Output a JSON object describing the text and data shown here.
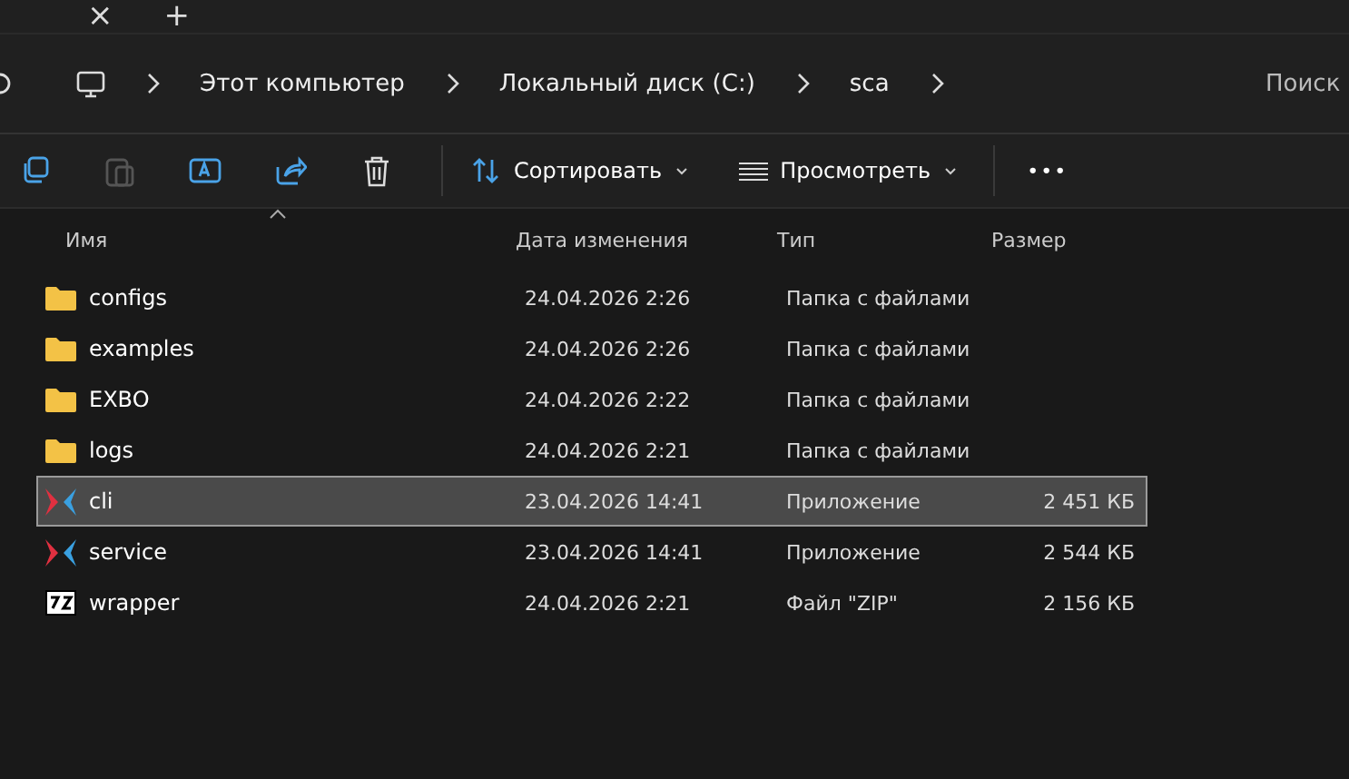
{
  "tab_strip": {
    "close": "×",
    "new_tab": "+"
  },
  "address_bar": {
    "crumbs": [
      "Этот компьютер",
      "Локальный диск (C:)",
      "sca"
    ],
    "search": {
      "placeholder": "Поиск"
    }
  },
  "toolbar": {
    "sort": "Сортировать",
    "view": "Просмотреть",
    "more": "•••"
  },
  "table": {
    "columns": [
      "Имя",
      "Дата изменения",
      "Тип",
      "Размер"
    ],
    "rows": [
      {
        "kind": "folder",
        "name": "configs",
        "date": "24.04.2026 2:26",
        "type": "Папка с файлами",
        "size": "",
        "selected": false
      },
      {
        "kind": "folder",
        "name": "examples",
        "date": "24.04.2026 2:26",
        "type": "Папка с файлами",
        "size": "",
        "selected": false
      },
      {
        "kind": "folder",
        "name": "EXBO",
        "date": "24.04.2026 2:22",
        "type": "Папка с файлами",
        "size": "",
        "selected": false
      },
      {
        "kind": "folder",
        "name": "logs",
        "date": "24.04.2026 2:21",
        "type": "Папка с файлами",
        "size": "",
        "selected": false
      },
      {
        "kind": "app",
        "name": "cli",
        "date": "23.04.2026 14:41",
        "type": "Приложение",
        "size": "2 451 КБ",
        "selected": true
      },
      {
        "kind": "app",
        "name": "service",
        "date": "23.04.2026 14:41",
        "type": "Приложение",
        "size": "2 544 КБ",
        "selected": false
      },
      {
        "kind": "archive",
        "name": "wrapper",
        "date": "24.04.2026 2:21",
        "type": "Файл \"ZIP\"",
        "size": "2 156 КБ",
        "selected": false
      }
    ]
  }
}
